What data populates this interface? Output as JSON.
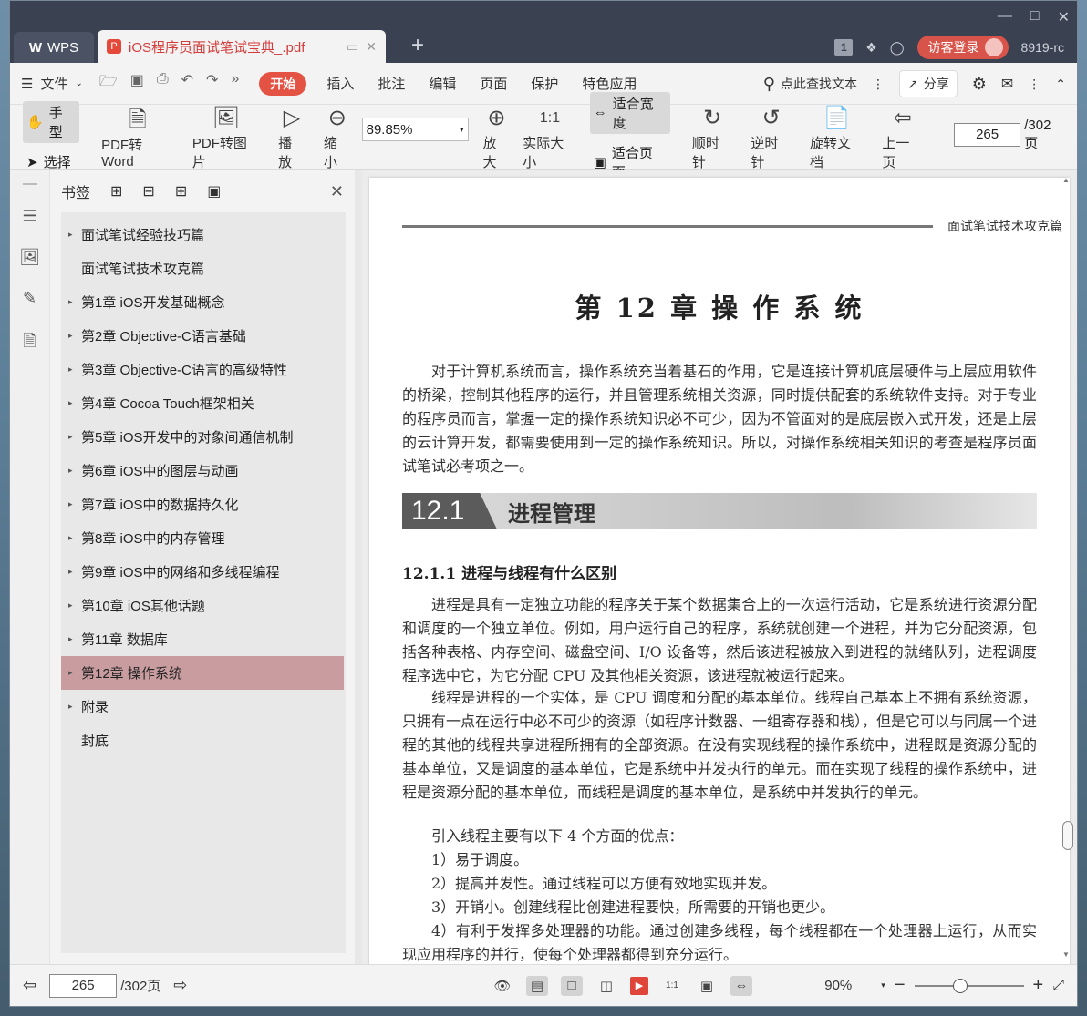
{
  "titlebar": {
    "wps_tab": "WPS",
    "doc_tab": "iOS程序员面试笔试宝典_.pdf",
    "badge": "1",
    "login": "访客登录",
    "user_code": "8919-rc"
  },
  "menubar": {
    "file": "文件",
    "start": "开始",
    "items": [
      "插入",
      "批注",
      "编辑",
      "页面",
      "保护",
      "特色应用"
    ],
    "search": "点此查找文本",
    "share": "分享"
  },
  "toolbar": {
    "hand": "手型",
    "select": "选择",
    "pdf_to_word": "PDF转Word",
    "pdf_to_image": "PDF转图片",
    "play": "播放",
    "zoom_out": "缩小",
    "zoom_value": "89.85%",
    "zoom_in": "放大",
    "actual_size": "实际大小",
    "fit_width": "适合宽度",
    "fit_page": "适合页面",
    "clockwise": "顺时针",
    "counterclockwise": "逆时针",
    "rotate_doc": "旋转文档",
    "prev_page": "上一页",
    "page_current": "265",
    "page_total": "/302页"
  },
  "sidebar": {
    "title": "书签",
    "items": [
      {
        "label": "面试笔试经验技巧篇",
        "expandable": true
      },
      {
        "label": "面试笔试技术攻克篇",
        "expandable": false
      },
      {
        "label": "第1章  iOS开发基础概念",
        "expandable": true
      },
      {
        "label": "第2章  Objective-C语言基础",
        "expandable": true
      },
      {
        "label": "第3章  Objective-C语言的高级特性",
        "expandable": true
      },
      {
        "label": "第4章  Cocoa Touch框架相关",
        "expandable": true
      },
      {
        "label": "第5章  iOS开发中的对象间通信机制",
        "expandable": true
      },
      {
        "label": "第6章  iOS中的图层与动画",
        "expandable": true
      },
      {
        "label": "第7章  iOS中的数据持久化",
        "expandable": true
      },
      {
        "label": "第8章  iOS中的内存管理",
        "expandable": true
      },
      {
        "label": "第9章  iOS中的网络和多线程编程",
        "expandable": true
      },
      {
        "label": "第10章  iOS其他话题",
        "expandable": true
      },
      {
        "label": "第11章  数据库",
        "expandable": true
      },
      {
        "label": "第12章  操作系统",
        "expandable": true,
        "selected": true
      },
      {
        "label": "附录",
        "expandable": true
      },
      {
        "label": "封底",
        "expandable": false
      }
    ]
  },
  "page": {
    "running_head": "面试笔试技术攻克篇",
    "chapter_title": "第 12 章   操 作 系 统",
    "intro": "对于计算机系统而言，操作系统充当着基石的作用，它是连接计算机底层硬件与上层应用软件的桥梁，控制其他程序的运行，并且管理系统相关资源，同时提供配套的系统软件支持。对于专业的程序员而言，掌握一定的操作系统知识必不可少，因为不管面对的是底层嵌入式开发，还是上层的云计算开发，都需要使用到一定的操作系统知识。所以，对操作系统相关知识的考查是程序员面试笔试必考项之一。",
    "section_num": "12.1",
    "section_name": "进程管理",
    "subsection": "12.1.1    进程与线程有什么区别",
    "para1": "进程是具有一定独立功能的程序关于某个数据集合上的一次运行活动，它是系统进行资源分配和调度的一个独立单位。例如，用户运行自己的程序，系统就创建一个进程，并为它分配资源，包括各种表格、内存空间、磁盘空间、I/O 设备等，然后该进程被放入到进程的就绪队列，进程调度程序选中它，为它分配 CPU 及其他相关资源，该进程就被运行起来。",
    "para2": "线程是进程的一个实体，是 CPU 调度和分配的基本单位。线程自己基本上不拥有系统资源，只拥有一点在运行中必不可少的资源（如程序计数器、一组寄存器和栈），但是它可以与同属一个进程的其他的线程共享进程所拥有的全部资源。在没有实现线程的操作系统中，进程既是资源分配的基本单位，又是调度的基本单位，它是系统中并发执行的单元。而在实现了线程的操作系统中，进程是资源分配的基本单位，而线程是调度的基本单位，是系统中并发执行的单元。",
    "para3": "引入线程主要有以下 4 个方面的优点：",
    "list": [
      "1）易于调度。",
      "2）提高并发性。通过线程可以方便有效地实现并发。",
      "3）开销小。创建线程比创建进程要快，所需要的开销也更少。",
      "4）有利于发挥多处理器的功能。通过创建多线程，每个线程都在一个处理器上运行，从而实现应用程序的并行，使每个处理器都得到充分运行。"
    ]
  },
  "statusbar": {
    "page_current": "265",
    "page_total": "/302页",
    "zoom": "90%"
  }
}
